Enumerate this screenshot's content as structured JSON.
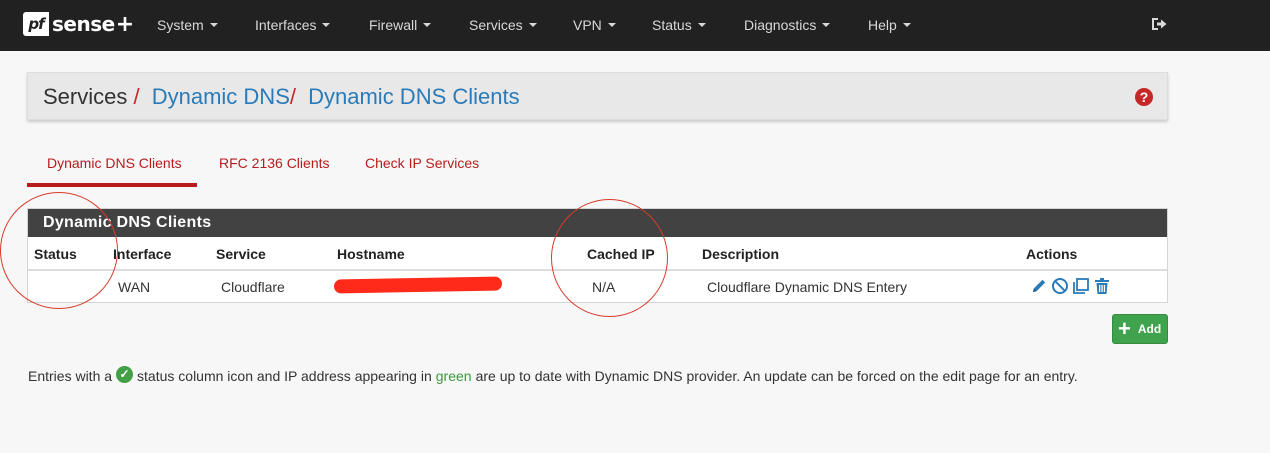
{
  "nav": {
    "logo_pf": "pf",
    "logo_sense": "sense",
    "logo_plus": "+",
    "items": [
      "System",
      "Interfaces",
      "Firewall",
      "Services",
      "VPN",
      "Status",
      "Diagnostics",
      "Help"
    ],
    "logout_icon": "sign-out-icon"
  },
  "breadcrumb": {
    "section": "Services",
    "sep": "/",
    "link1": "Dynamic DNS",
    "link2": "Dynamic DNS Clients",
    "help_icon": "question-circle-icon"
  },
  "tabs": [
    "Dynamic DNS Clients",
    "RFC 2136 Clients",
    "Check IP Services"
  ],
  "active_tab": "Dynamic DNS Clients",
  "panel": {
    "title": "Dynamic DNS Clients",
    "columns": [
      "Status",
      "Interface",
      "Service",
      "Hostname",
      "Cached IP",
      "Description",
      "Actions"
    ],
    "rows": [
      {
        "status": "",
        "interface": "WAN",
        "service": "Cloudflare",
        "hostname": "",
        "cached_ip": "N/A",
        "description": "Cloudflare Dynamic DNS Entery",
        "actions": [
          "pencil-icon",
          "disable-icon",
          "copy-icon",
          "trash-icon"
        ]
      }
    ]
  },
  "add_button": {
    "label": "Add",
    "icon": "plus-icon"
  },
  "info": {
    "part1": "Entries with a",
    "part2": "status column icon and IP address appearing in",
    "green": "green",
    "part3": "are up to date with Dynamic DNS provider. An update can be forced on the edit page for an entry."
  },
  "colors": {
    "navbar": "#212121",
    "link_blue": "#2a7bb8",
    "tab_red": "#b71c1c",
    "panel_heading": "#424242",
    "add_green": "#3fa34d",
    "annotation_red": "#d93a2b",
    "action_blue": "#2a7bb8"
  }
}
